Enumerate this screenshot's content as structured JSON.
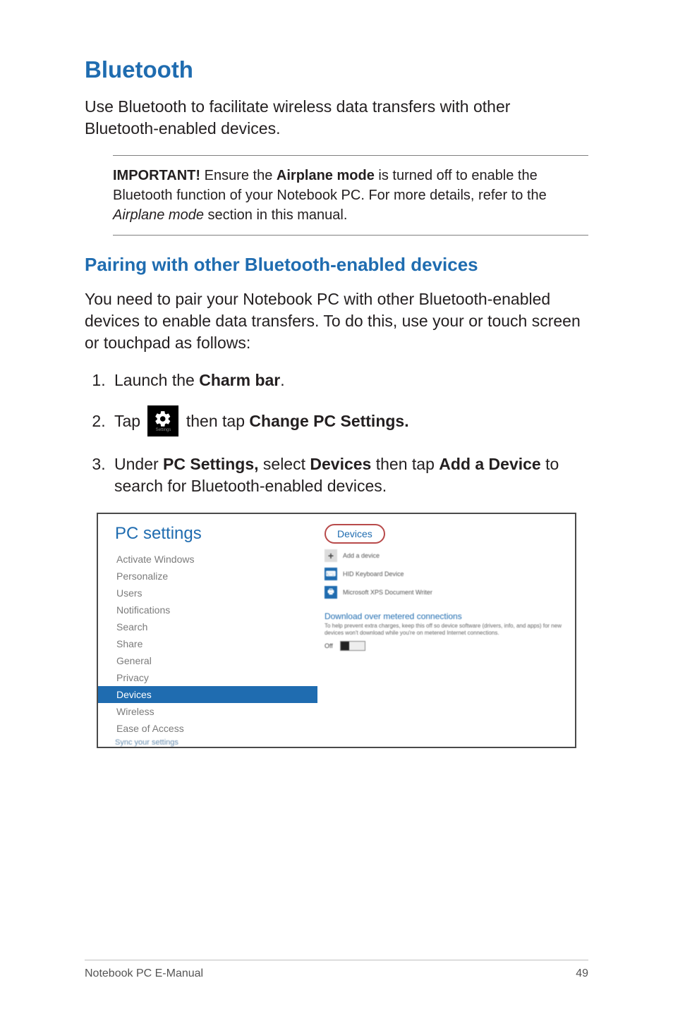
{
  "headings": {
    "main": "Bluetooth",
    "sub": "Pairing with other Bluetooth-enabled devices"
  },
  "paragraphs": {
    "intro": "Use Bluetooth to facilitate wireless data transfers with other Bluetooth-enabled devices.",
    "pair_intro": "You need to pair your Notebook PC with other Bluetooth-enabled devices to enable data transfers. To do this, use your or touch screen or touchpad as follows:"
  },
  "note": {
    "prefix": "IMPORTANT!",
    "part1": " Ensure the ",
    "em1": "Airplane mode",
    "part2": " is turned off to enable the Bluetooth function of your Notebook PC. For more details, refer to the ",
    "ital": "Airplane mode",
    "part3": " section in this manual."
  },
  "steps": {
    "s1_a": "Launch the ",
    "s1_b": "Charm bar",
    "s1_c": ".",
    "s2_a": "Tap ",
    "s2_b": " then tap ",
    "s2_c": "Change PC Settings.",
    "s3_a": "Under ",
    "s3_b": "PC Settings,",
    "s3_c": " select ",
    "s3_d": "Devices",
    "s3_e": " then tap ",
    "s3_f": "Add a Device",
    "s3_g": " to search for Bluetooth-enabled devices.",
    "icon_label": "Settings"
  },
  "screenshot": {
    "title": "PC settings",
    "menu": {
      "m0": "Activate Windows",
      "m1": "Personalize",
      "m2": "Users",
      "m3": "Notifications",
      "m4": "Search",
      "m5": "Share",
      "m6": "General",
      "m7": "Privacy",
      "m8": "Devices",
      "m9": "Wireless",
      "m10": "Ease of Access",
      "m11": "Sync your settings"
    },
    "devices_label": "Devices",
    "add_device": "Add a device",
    "dev1": "HID Keyboard Device",
    "dev2": "Microsoft XPS Document Writer",
    "download_head": "Download over metered connections",
    "download_text": "To help prevent extra charges, keep this off so device software (drivers, info, and apps) for new devices won't download while you're on metered Internet connections.",
    "off_label": "Off"
  },
  "footer": {
    "left": "Notebook PC E-Manual",
    "right": "49"
  }
}
